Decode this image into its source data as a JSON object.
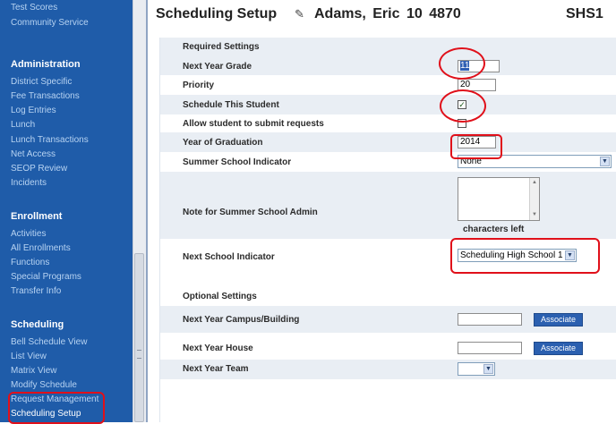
{
  "sidebar": {
    "top_links": [
      "Test Scores",
      "Community Service"
    ],
    "sections": [
      {
        "title": "Administration",
        "items": [
          "District Specific",
          "Fee Transactions",
          "Log Entries",
          "Lunch",
          "Lunch Transactions",
          "Net Access",
          "SEOP Review",
          "Incidents"
        ]
      },
      {
        "title": "Enrollment",
        "items": [
          "Activities",
          "All Enrollments",
          "Functions",
          "Special Programs",
          "Transfer Info"
        ]
      },
      {
        "title": "Scheduling",
        "items": [
          "Bell Schedule View",
          "List View",
          "Matrix View",
          "Modify Schedule",
          "Request Management",
          "Scheduling Setup"
        ]
      }
    ]
  },
  "header": {
    "title": "Scheduling Setup",
    "icon": "student-icon",
    "student_name": "Adams, Eric",
    "grade": "10",
    "student_id": "4870",
    "school": "SHS1"
  },
  "form": {
    "required_heading": "Required Settings",
    "next_year_grade": {
      "label": "Next Year Grade",
      "value": "11"
    },
    "priority": {
      "label": "Priority",
      "value": "20"
    },
    "schedule_student": {
      "label": "Schedule This Student",
      "checked": true
    },
    "allow_requests": {
      "label": "Allow student to submit requests",
      "checked": false
    },
    "graduation_year": {
      "label": "Year of Graduation",
      "value": "2014"
    },
    "summer_school": {
      "label": "Summer School Indicator",
      "value": "None"
    },
    "summer_note": {
      "label": "Note for Summer School Admin",
      "chars_left": "characters left"
    },
    "next_school": {
      "label": "Next School Indicator",
      "value": "Scheduling High School 1"
    },
    "optional_heading": "Optional Settings",
    "campus": {
      "label": "Next Year Campus/Building",
      "value": "",
      "button": "Associate"
    },
    "house": {
      "label": "Next Year House",
      "value": "",
      "button": "Associate"
    },
    "team": {
      "label": "Next Year Team",
      "value": ""
    }
  },
  "colors": {
    "sidebar_bg": "#1f5ca9",
    "link": "#b7d3f2",
    "row_shade": "#e9eef4",
    "button": "#2b60b0",
    "annotation": "#e0101a"
  }
}
